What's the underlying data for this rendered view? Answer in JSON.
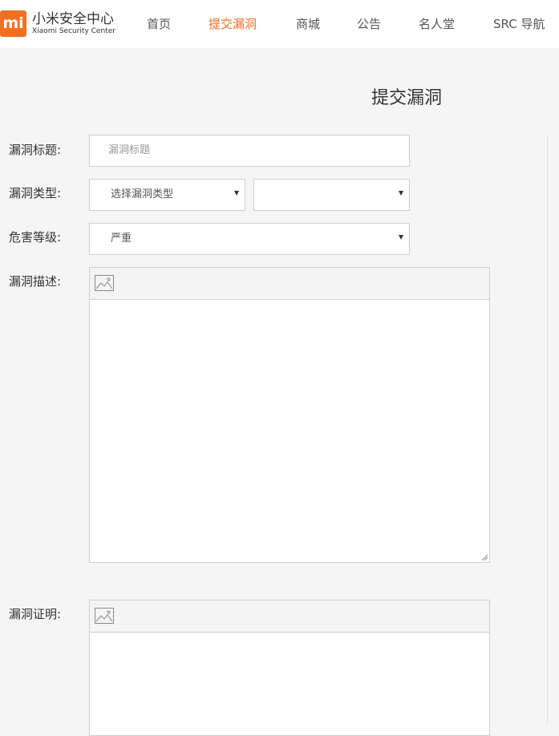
{
  "header": {
    "logo_mark": "mi",
    "logo_name_cn": "小米安全中心",
    "logo_name_en": "Xiaomi Security Center",
    "nav": [
      {
        "label": "首页",
        "active": false
      },
      {
        "label": "提交漏洞",
        "active": true
      },
      {
        "label": "商城",
        "active": false
      },
      {
        "label": "公告",
        "active": false
      },
      {
        "label": "名人堂",
        "active": false
      },
      {
        "label": "SRC 导航",
        "active": false
      }
    ]
  },
  "page_title": "提交漏洞",
  "form": {
    "title_label": "漏洞标题:",
    "title_placeholder": "漏洞标题",
    "type_label": "漏洞类型:",
    "type_select": "选择漏洞类型",
    "subtype_select": "",
    "severity_label": "危害等级:",
    "severity_select": "严重",
    "description_label": "漏洞描述:",
    "proof_label": "漏洞证明:"
  },
  "icons": {
    "insert_image": "image-icon",
    "dropdown": "caret-down-icon"
  },
  "colors": {
    "accent": "#f26f21",
    "background": "#f5f5f5",
    "border": "#cfcfcf"
  }
}
